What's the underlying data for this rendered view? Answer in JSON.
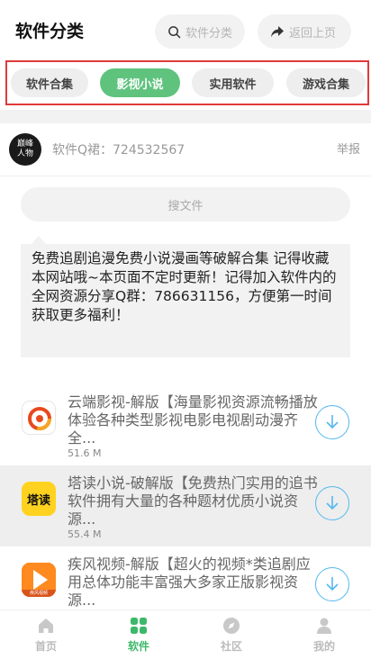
{
  "header": {
    "title": "软件分类",
    "search_label": "软件分类",
    "search_icon": "search-icon",
    "back_label": "返回上页",
    "back_icon": "share-arrow-icon"
  },
  "tabs": [
    {
      "label": "软件合集",
      "active": false
    },
    {
      "label": "影视小说",
      "active": true
    },
    {
      "label": "实用软件",
      "active": false
    },
    {
      "label": "游戏合集",
      "active": false
    }
  ],
  "post": {
    "avatar_line1": "巅峰",
    "avatar_line2": "人物",
    "qq_group": "软件Q裙：724532567",
    "report_label": "举报",
    "search_placeholder": "搜文件",
    "announcement": "免费追剧追漫免费小说漫画等破解合集 记得收藏本网站哦~本页面不定时更新！记得加入软件内的全网资源分享Q群：786631156，方便第一时间获取更多福利！"
  },
  "apps": [
    {
      "title": "云端影视-解版【海量影视资源流畅播放体验各种类型影视电影电视剧动漫齐全...",
      "size": "51.6 M",
      "icon": "yunduan-app-icon"
    },
    {
      "title": "塔读小说-破解版【免费热门实用的追书软件拥有大量的各种题材优质小说资源...",
      "size": "55.4 M",
      "icon": "tadu-app-icon",
      "icon_text": "塔读"
    },
    {
      "title": "疾风视频-解版【超火的视频*类追剧应用总体功能丰富强大多家正版影视资源...",
      "size": "",
      "icon": "jifeng-app-icon",
      "icon_text": "疾风视频"
    }
  ],
  "nav": [
    {
      "label": "首页",
      "icon": "home-icon",
      "active": false
    },
    {
      "label": "软件",
      "icon": "grid-icon",
      "active": true
    },
    {
      "label": "社区",
      "icon": "compass-icon",
      "active": false
    },
    {
      "label": "我的",
      "icon": "person-icon",
      "active": false
    }
  ],
  "colors": {
    "accent_green": "#5fc37e",
    "highlight_red": "#e03a3a",
    "download_blue": "#54b8ee"
  }
}
